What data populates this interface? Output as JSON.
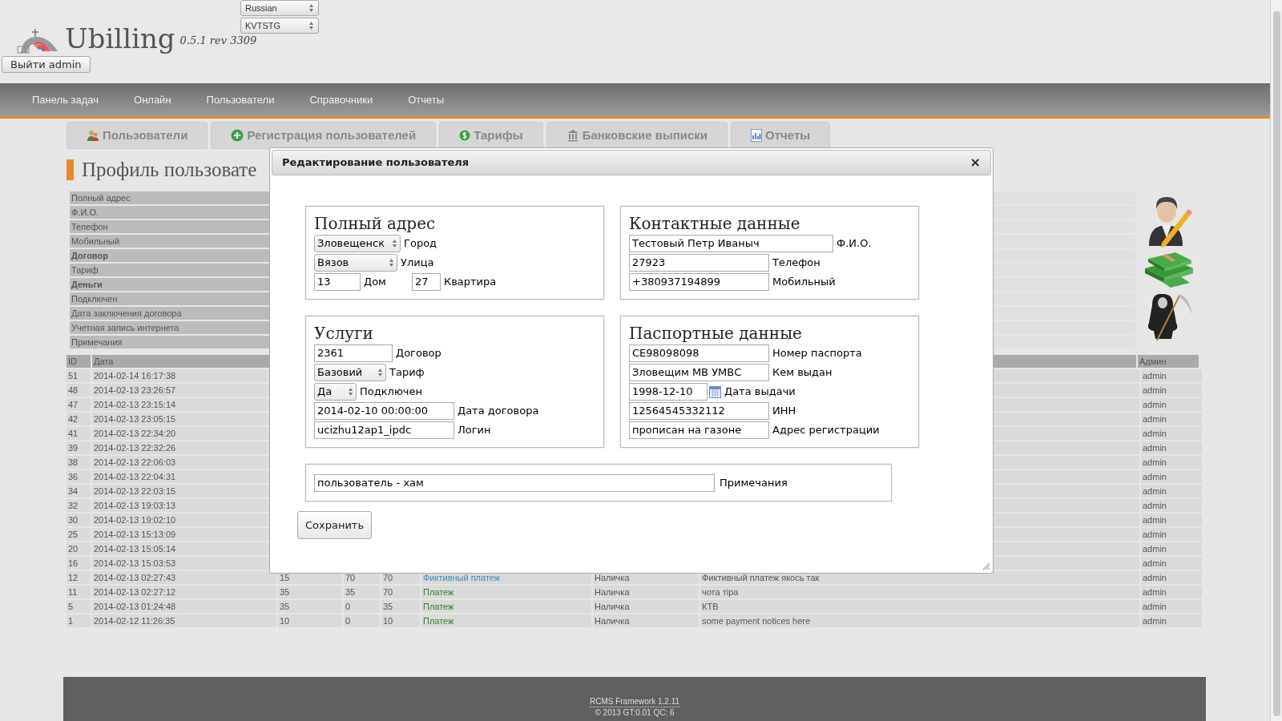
{
  "header": {
    "logo_text": "Ubilling",
    "version": "0.5.1 rev 3309",
    "language": "Russian",
    "branch": "KVTSTG",
    "logout": "Выйти admin"
  },
  "nav": [
    "Панель задач",
    "Онлайн",
    "Пользователи",
    "Справочники",
    "Отчеты"
  ],
  "tabs": [
    {
      "label": "Пользователи",
      "kind": "users"
    },
    {
      "label": "Регистрация пользователей",
      "kind": "add"
    },
    {
      "label": "Тарифы",
      "kind": "tariff"
    },
    {
      "label": "Банковские выписки",
      "kind": "bank"
    },
    {
      "label": "Отчеты",
      "kind": "report"
    }
  ],
  "profile": {
    "title": "Профиль пользовате",
    "fields": [
      {
        "label": "Полный адрес",
        "bold": false
      },
      {
        "label": "Ф.И.О.",
        "bold": false
      },
      {
        "label": "Телефон",
        "bold": false
      },
      {
        "label": "Мобильный",
        "bold": false
      },
      {
        "label": "Договор",
        "bold": true
      },
      {
        "label": "Тариф",
        "bold": false
      },
      {
        "label": "Деньги",
        "bold": true
      },
      {
        "label": "Подключен",
        "bold": false
      },
      {
        "label": "Дата заключения договора",
        "bold": false
      },
      {
        "label": "Учетная запись интернета",
        "bold": false
      },
      {
        "label": "Примечания",
        "bold": false
      }
    ]
  },
  "payments": {
    "columns": {
      "id": "ID",
      "date": "Дата",
      "admin": "Админ"
    },
    "rows": [
      {
        "id": "51",
        "date": "2014-02-14 16:17:38",
        "admin": "admin"
      },
      {
        "id": "48",
        "date": "2014-02-13 23:26:57",
        "admin": "admin"
      },
      {
        "id": "47",
        "date": "2014-02-13 23:15:14",
        "admin": "admin"
      },
      {
        "id": "42",
        "date": "2014-02-13 23:05:15",
        "admin": "admin"
      },
      {
        "id": "41",
        "date": "2014-02-13 22:34:20",
        "admin": "admin"
      },
      {
        "id": "39",
        "date": "2014-02-13 22:32:26",
        "admin": "admin"
      },
      {
        "id": "38",
        "date": "2014-02-13 22:06:03",
        "admin": "admin"
      },
      {
        "id": "36",
        "date": "2014-02-13 22:04:31",
        "admin": "admin"
      },
      {
        "id": "34",
        "date": "2014-02-13 22:03:15",
        "admin": "admin"
      },
      {
        "id": "32",
        "date": "2014-02-13 19:03:13",
        "admin": "admin"
      },
      {
        "id": "30",
        "date": "2014-02-13 19:02:10",
        "admin": "admin"
      },
      {
        "id": "25",
        "date": "2014-02-13 15:13:09",
        "admin": "admin"
      },
      {
        "id": "20",
        "date": "2014-02-13 15:05:14",
        "admin": "admin"
      },
      {
        "id": "16",
        "date": "2014-02-13 15:03:53",
        "admin": "admin"
      },
      {
        "id": "12",
        "date": "2014-02-13 02:27:43",
        "column_3": "15",
        "column_4": "70",
        "column_5": "70",
        "column_6": "Фиктивный платеж",
        "color": "#3a8fc0",
        "column_7": "Наличка",
        "column_8": "Фиктивный платеж якось так",
        "admin": "admin"
      },
      {
        "id": "11",
        "date": "2014-02-13 02:27:12",
        "column_3": "35",
        "column_4": "35",
        "column_5": "70",
        "column_6": "Платеж",
        "color": "#2e7d32",
        "column_7": "Наличка",
        "column_8": "чота тipa",
        "admin": "admin"
      },
      {
        "id": "5",
        "date": "2014-02-13 01:24:48",
        "column_3": "35",
        "column_4": "0",
        "column_5": "35",
        "column_6": "Платеж",
        "color": "#2e7d32",
        "column_7": "Наличка",
        "column_8": "КТВ",
        "admin": "admin"
      },
      {
        "id": "1",
        "date": "2014-02-12 11:26:35",
        "column_3": "10",
        "column_4": "0",
        "column_5": "10",
        "column_6": "Платеж",
        "color": "#2e7d32",
        "column_7": "Наличка",
        "column_8": "some payment notices here",
        "admin": "admin"
      }
    ]
  },
  "dialog": {
    "title": "Редактирование пользователя",
    "close": "×",
    "sections": [
      {
        "legend": "Полный адрес",
        "rows": [
          [
            {
              "kind": "select",
              "value": "Зловещенск",
              "label": "Город"
            }
          ],
          [
            {
              "kind": "select",
              "value": "Вязов",
              "label": "Улица"
            }
          ],
          [
            {
              "kind": "input",
              "value": "13",
              "label": "Дом"
            },
            {
              "kind": "input",
              "value": "27",
              "label": "Квартира"
            }
          ]
        ]
      },
      {
        "legend": "Контактные данные",
        "rows": [
          [
            {
              "kind": "input",
              "value": "Тестовый Петр Иваныч",
              "label": "Ф.И.О."
            }
          ],
          [
            {
              "kind": "input",
              "value": "27923",
              "label": "Телефон"
            }
          ],
          [
            {
              "kind": "input",
              "value": "+380937194899",
              "label": "Мобильный"
            }
          ]
        ]
      },
      {
        "legend": "Услуги",
        "rows": [
          [
            {
              "kind": "input",
              "value": "2361",
              "label": "Договор"
            }
          ],
          [
            {
              "kind": "select",
              "value": "Базовий",
              "label": "Тариф"
            }
          ],
          [
            {
              "kind": "select",
              "value": "Да",
              "label": "Подключен"
            }
          ],
          [
            {
              "kind": "input",
              "value": "2014-02-10 00:00:00",
              "label": "Дата договора"
            }
          ],
          [
            {
              "kind": "input",
              "value": "ucizhu12ap1_ipdc",
              "label": "Логин"
            }
          ]
        ]
      },
      {
        "legend": "Паспортные данные",
        "rows": [
          [
            {
              "kind": "input",
              "value": "CE98098098",
              "label": "Номер паспорта"
            }
          ],
          [
            {
              "kind": "input",
              "value": "Зловещим МВ УМВС",
              "label": "Кем выдан"
            }
          ],
          [
            {
              "kind": "date",
              "value": "1998-12-10",
              "label": "Дата выдачи"
            }
          ],
          [
            {
              "kind": "input",
              "value": "12564545332112",
              "label": "ИНН"
            }
          ],
          [
            {
              "kind": "input",
              "value": "прописан на газоне",
              "label": "Адрес регистрации"
            }
          ]
        ]
      }
    ],
    "notes": {
      "value": "пользователь - хам",
      "label": "Примечания"
    },
    "save": "Сохранить"
  },
  "footer": {
    "framework": "RCMS Framework 1.2.11",
    "copyright": "© 2013 GT:0.01 QC: 6"
  }
}
